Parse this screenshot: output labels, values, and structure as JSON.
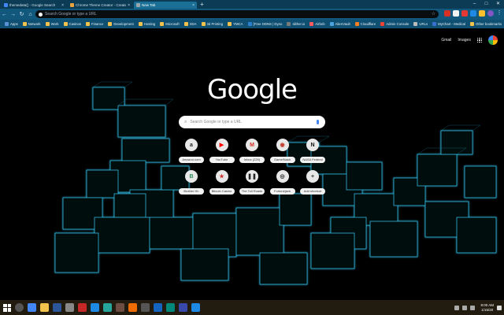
{
  "tabs": [
    {
      "title": "themedata() - Google Search",
      "color": "#4285f4",
      "active": false
    },
    {
      "title": "Chrome Theme Creator - Create",
      "color": "#e8a33d",
      "active": false
    },
    {
      "title": "New Tab",
      "color": "#9aa6ad",
      "active": true
    }
  ],
  "window_controls": {
    "minimize": "–",
    "maximize": "□",
    "close": "✕"
  },
  "omnibox": {
    "placeholder": "Search Google or type a URL"
  },
  "bookmarks": [
    {
      "label": "Apps",
      "color": "#5b8fd6",
      "type": "app"
    },
    {
      "label": "Network",
      "type": "folder"
    },
    {
      "label": "Work",
      "type": "folder"
    },
    {
      "label": "Casinos",
      "type": "folder"
    },
    {
      "label": "Finance",
      "type": "folder"
    },
    {
      "label": "Development",
      "type": "folder"
    },
    {
      "label": "Hosting",
      "type": "folder"
    },
    {
      "label": "Microsoft",
      "type": "folder"
    },
    {
      "label": "XDA",
      "type": "folder"
    },
    {
      "label": "3d Printing",
      "type": "folder"
    },
    {
      "label": "YMCA",
      "type": "folder"
    },
    {
      "label": "[Free DDNS | Dyno",
      "color": "#2c7fcf",
      "type": "link"
    },
    {
      "label": "slither.io",
      "color": "#7a7a7a",
      "type": "link"
    },
    {
      "label": "Airbnb",
      "color": "#ff5a5f",
      "type": "link"
    },
    {
      "label": "AlienVault",
      "color": "#4aa3df",
      "type": "link"
    },
    {
      "label": "Cloudflare",
      "color": "#f38020",
      "type": "link"
    },
    {
      "label": "Admin Console",
      "color": "#ea4335",
      "type": "link"
    },
    {
      "label": "URLs",
      "color": "#bbbbbb",
      "type": "link"
    },
    {
      "label": "MyChart - Medical",
      "color": "#3b6ecf",
      "type": "link"
    }
  ],
  "other_bookmarks": "Other bookmarks",
  "header": {
    "gmail": "Gmail",
    "images": "Images"
  },
  "logo": "Google",
  "search": {
    "placeholder": "Search Google or type a URL"
  },
  "shortcuts": [
    {
      "label": "Amazon.com",
      "glyph": "a",
      "color": "#222222"
    },
    {
      "label": "YouTube",
      "glyph": "▶",
      "color": "#ff0000"
    },
    {
      "label": "Inbox (229)",
      "glyph": "M",
      "color": "#d93025"
    },
    {
      "label": "GameStash",
      "glyph": "◉",
      "color": "#c0392b"
    },
    {
      "label": "NASA Federal",
      "glyph": "N",
      "color": "#111111"
    },
    {
      "label": "Brother HL",
      "glyph": "B",
      "color": "#2e8b57"
    },
    {
      "label": "Bitcoin Casino",
      "glyph": "★",
      "color": "#d32f2f"
    },
    {
      "label": "The Toll Roads",
      "glyph": "❚❚",
      "color": "#222222"
    },
    {
      "label": "Fortunejack",
      "glyph": "◎",
      "color": "#222222"
    },
    {
      "label": "Add shortcut",
      "glyph": "+",
      "color": "#333333"
    }
  ],
  "taskbar_icons": [
    {
      "name": "search-icon",
      "color": "#555555"
    },
    {
      "name": "chrome-icon",
      "color": "#4285f4"
    },
    {
      "name": "explorer-icon",
      "color": "#f3c24c"
    },
    {
      "name": "app-icon",
      "color": "#2b579a"
    },
    {
      "name": "app-icon",
      "color": "#888888"
    },
    {
      "name": "app-icon",
      "color": "#c62828"
    },
    {
      "name": "app-icon",
      "color": "#1e88e5"
    },
    {
      "name": "app-icon",
      "color": "#26a69a"
    },
    {
      "name": "app-icon",
      "color": "#6d4c41"
    },
    {
      "name": "app-icon",
      "color": "#ef6c00"
    },
    {
      "name": "app-icon",
      "color": "#555555"
    },
    {
      "name": "app-icon",
      "color": "#1565c0"
    },
    {
      "name": "app-icon",
      "color": "#00897b"
    },
    {
      "name": "app-icon",
      "color": "#3949ab"
    },
    {
      "name": "app-icon",
      "color": "#1e88e5"
    }
  ],
  "clock": {
    "time": "8:00 AM",
    "date": "1/15/20"
  }
}
